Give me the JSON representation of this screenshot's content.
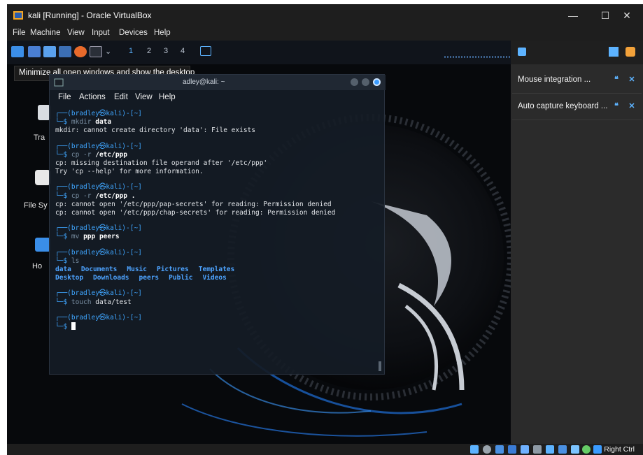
{
  "window": {
    "title": "kali [Running] - Oracle VirtualBox",
    "controls": {
      "minimize": "—",
      "maximize": "☐",
      "close": "✕"
    }
  },
  "menubar": [
    "File",
    "Machine",
    "View",
    "Input",
    "Devices",
    "Help"
  ],
  "guest_panel": {
    "workspaces": [
      "1",
      "2",
      "3",
      "4"
    ],
    "tooltip": "Minimize all open windows and show the desktop"
  },
  "desktop": {
    "icons": [
      "Tra",
      "File Sy",
      "Ho"
    ]
  },
  "terminal": {
    "title": "adley@kali: ~",
    "menu": [
      "File",
      "Actions",
      "Edit",
      "View",
      "Help"
    ],
    "prompt_user": "(bradley㉿kali)-[~]",
    "blocks": [
      {
        "cmd": "mkdir",
        "arg": "data",
        "output": [
          "mkdir: cannot create directory 'data': File exists"
        ]
      },
      {
        "cmd": "cp -r",
        "arg": "/etc/ppp",
        "output": [
          "cp: missing destination file operand after '/etc/ppp'",
          "Try 'cp --help' for more information."
        ]
      },
      {
        "cmd": "cp -r",
        "arg": "/etc/ppp .",
        "output": [
          "cp: cannot open '/etc/ppp/pap-secrets' for reading: Permission denied",
          "cp: cannot open '/etc/ppp/chap-secrets' for reading: Permission denied"
        ]
      },
      {
        "cmd": "mv",
        "arg": "ppp peers",
        "output": []
      },
      {
        "cmd": "ls",
        "arg": "",
        "output": []
      },
      {
        "cmd": "touch",
        "arg": "data/test",
        "output": []
      }
    ],
    "ls_rows": [
      [
        "data",
        "Documents",
        "Music",
        "Pictures",
        "Templates"
      ],
      [
        "Desktop",
        "Downloads",
        "peers",
        "Public",
        "Videos"
      ]
    ]
  },
  "notifications": [
    {
      "text": "Mouse integration ..."
    },
    {
      "text": "Auto capture keyboard ..."
    }
  ],
  "statusbar": {
    "host_key": "Right Ctrl"
  },
  "colors": {
    "accent": "#3fa6ff",
    "titlebar": "#1e1e1e",
    "terminal_bg": "#141c26"
  }
}
